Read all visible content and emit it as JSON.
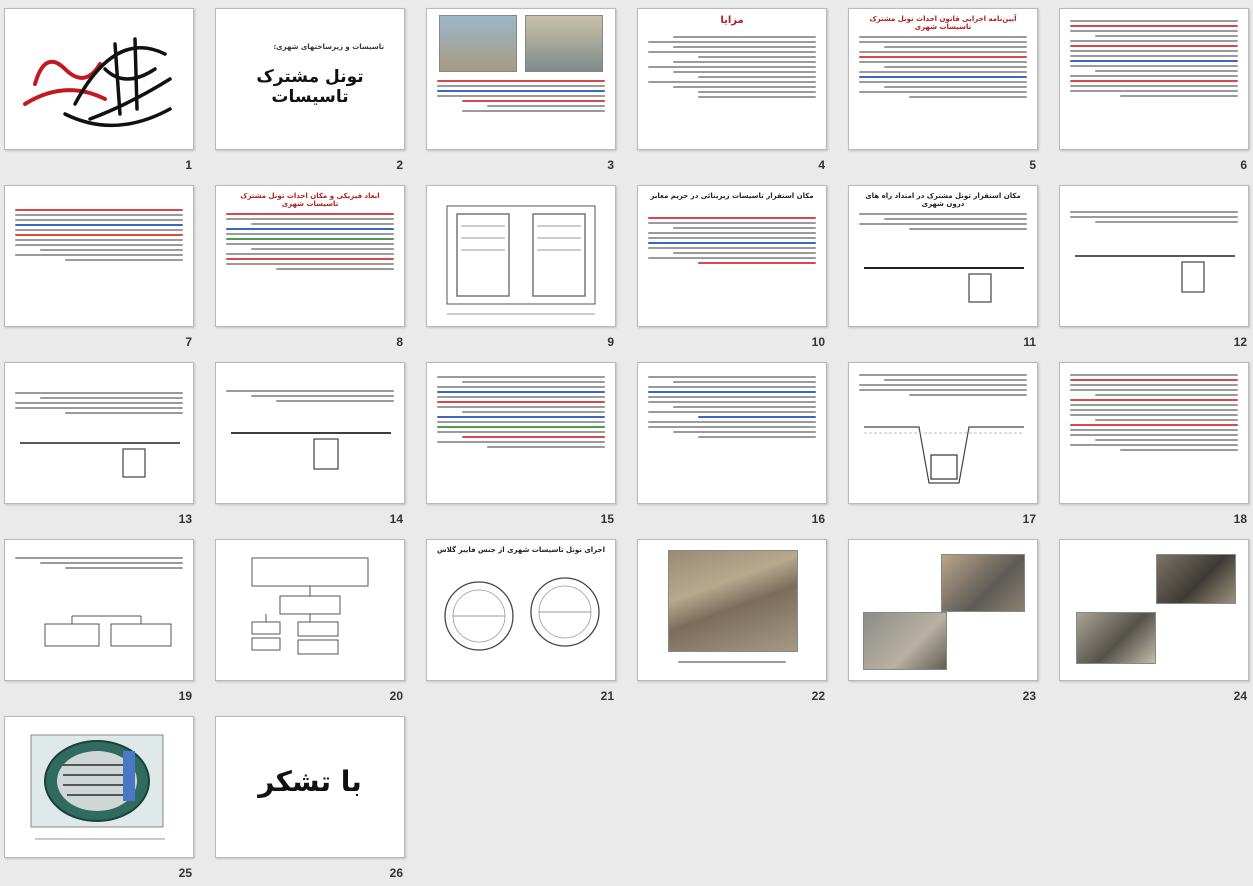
{
  "slides": [
    {
      "num": "1",
      "kind": "calligraphy"
    },
    {
      "num": "2",
      "kind": "title",
      "subtitle": "تاسیسات و زیرساختهای شهری:",
      "title": "تونل مشترک تاسیسات"
    },
    {
      "num": "3",
      "kind": "text-photo"
    },
    {
      "num": "4",
      "kind": "checklist",
      "title": "مزایا"
    },
    {
      "num": "5",
      "kind": "text",
      "title": "آیین‌نامه اجرایی قانون احداث تونل مشترک تاسیسات شهری"
    },
    {
      "num": "6",
      "kind": "text"
    },
    {
      "num": "7",
      "kind": "text"
    },
    {
      "num": "8",
      "kind": "text",
      "title": "ابعاد فیزیکی و مکان احداث تونل مشترک تاسیسات شهری"
    },
    {
      "num": "9",
      "kind": "drawing"
    },
    {
      "num": "10",
      "kind": "text",
      "title": "مکان استقرار تاسیسات زیربنائی در حریم معابر"
    },
    {
      "num": "11",
      "kind": "diagram",
      "title": "مکان استقرار تونل مشترک در امتداد راه های درون شهری"
    },
    {
      "num": "12",
      "kind": "diagram"
    },
    {
      "num": "13",
      "kind": "diagram"
    },
    {
      "num": "14",
      "kind": "diagram"
    },
    {
      "num": "15",
      "kind": "text"
    },
    {
      "num": "16",
      "kind": "text"
    },
    {
      "num": "17",
      "kind": "drawing"
    },
    {
      "num": "18",
      "kind": "text"
    },
    {
      "num": "19",
      "kind": "chart"
    },
    {
      "num": "20",
      "kind": "chart"
    },
    {
      "num": "21",
      "kind": "circles",
      "title": "اجرای تونل تاسیسات شهری از جنس فایبر گلاس"
    },
    {
      "num": "22",
      "kind": "photo"
    },
    {
      "num": "23",
      "kind": "photo"
    },
    {
      "num": "24",
      "kind": "photo"
    },
    {
      "num": "25",
      "kind": "render"
    },
    {
      "num": "26",
      "kind": "thanks",
      "text": "با تشکر"
    }
  ]
}
